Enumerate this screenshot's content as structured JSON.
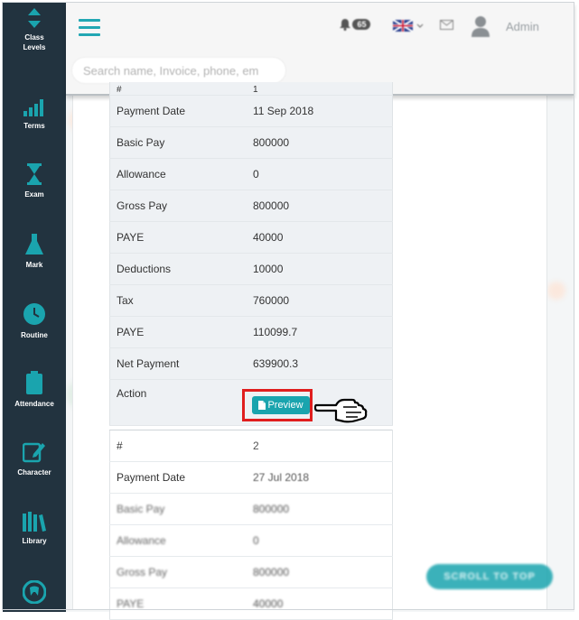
{
  "sidebar": {
    "items": [
      {
        "label": "Class Levels",
        "icon": "class-levels-icon"
      },
      {
        "label": "Terms",
        "icon": "chart-icon"
      },
      {
        "label": "Exam",
        "icon": "hourglass-icon"
      },
      {
        "label": "Mark",
        "icon": "flask-icon"
      },
      {
        "label": "Routine",
        "icon": "clock-icon"
      },
      {
        "label": "Attendance",
        "icon": "clipboard-icon"
      },
      {
        "label": "Character",
        "icon": "edit-icon"
      },
      {
        "label": "Library",
        "icon": "books-icon"
      },
      {
        "label": "",
        "icon": "tooth-icon"
      }
    ]
  },
  "header": {
    "search_placeholder": "Search name, Invoice, phone, em",
    "notification_count": "65",
    "user_name": "Admin"
  },
  "payments": [
    {
      "rows": [
        {
          "label": "#",
          "value": "1"
        },
        {
          "label": "Payment Date",
          "value": "11 Sep 2018"
        },
        {
          "label": "Basic Pay",
          "value": "800000"
        },
        {
          "label": "Allowance",
          "value": "0"
        },
        {
          "label": "Gross Pay",
          "value": "800000"
        },
        {
          "label": "PAYE",
          "value": "40000"
        },
        {
          "label": "Deductions",
          "value": "10000"
        },
        {
          "label": "Tax",
          "value": "760000"
        },
        {
          "label": "PAYE",
          "value": "110099.7"
        },
        {
          "label": "Net Payment",
          "value": "639900.3"
        }
      ],
      "action_label": "Action",
      "preview_label": "Preview"
    },
    {
      "rows": [
        {
          "label": "#",
          "value": "2"
        },
        {
          "label": "Payment Date",
          "value": "27 Jul 2018"
        },
        {
          "label": "Basic Pay",
          "value": "800000"
        },
        {
          "label": "Allowance",
          "value": "0"
        },
        {
          "label": "Gross Pay",
          "value": "800000"
        },
        {
          "label": "PAYE",
          "value": "40000"
        }
      ]
    }
  ],
  "scroll_to_top_label": "SCROLL TO TOP",
  "colors": {
    "sidebar": "#22333f",
    "accent": "#1aa4ae",
    "highlight": "#e01e1e"
  }
}
